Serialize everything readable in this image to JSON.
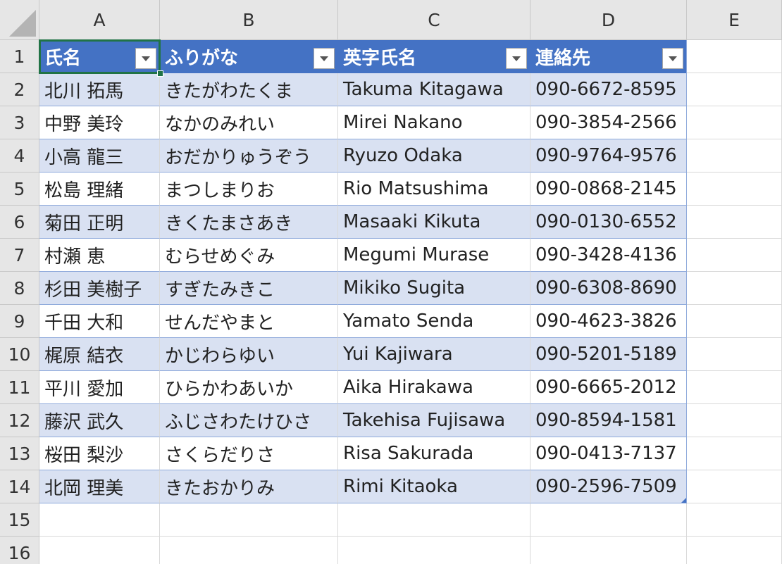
{
  "columns": [
    "A",
    "B",
    "C",
    "D",
    "E"
  ],
  "rows": [
    "1",
    "2",
    "3",
    "4",
    "5",
    "6",
    "7",
    "8",
    "9",
    "10",
    "11",
    "12",
    "13",
    "14",
    "15",
    "16"
  ],
  "table": {
    "headers": [
      "氏名",
      "ふりがな",
      "英字氏名",
      "連絡先"
    ],
    "records": [
      [
        "北川 拓馬",
        "きたがわたくま",
        "Takuma Kitagawa",
        "090-6672-8595"
      ],
      [
        "中野 美玲",
        "なかのみれい",
        "Mirei Nakano",
        "090-3854-2566"
      ],
      [
        "小高 龍三",
        "おだかりゅうぞう",
        "Ryuzo Odaka",
        "090-9764-9576"
      ],
      [
        "松島 理緒",
        "まつしまりお",
        "Rio Matsushima",
        "090-0868-2145"
      ],
      [
        "菊田 正明",
        "きくたまさあき",
        "Masaaki Kikuta",
        "090-0130-6552"
      ],
      [
        "村瀬 恵",
        "むらせめぐみ",
        "Megumi Murase",
        "090-3428-4136"
      ],
      [
        "杉田 美樹子",
        "すぎたみきこ",
        "Mikiko Sugita",
        "090-6308-8690"
      ],
      [
        "千田 大和",
        "せんだやまと",
        "Yamato Senda",
        "090-4623-3826"
      ],
      [
        "梶原 結衣",
        "かじわらゆい",
        "Yui Kajiwara",
        "090-5201-5189"
      ],
      [
        "平川 愛加",
        "ひらかわあいか",
        "Aika Hirakawa",
        "090-6665-2012"
      ],
      [
        "藤沢 武久",
        "ふじさわたけひさ",
        "Takehisa Fujisawa",
        "090-8594-1581"
      ],
      [
        "桜田 梨沙",
        "さくらだりさ",
        "Risa Sakurada",
        "090-0413-7137"
      ],
      [
        "北岡 理美",
        "きたおかりみ",
        "Rimi Kitaoka",
        "090-2596-7509"
      ]
    ]
  },
  "selected_cell": "A1",
  "colors": {
    "header_fill": "#4472c4",
    "band_fill": "#d9e1f2",
    "selection": "#217346"
  }
}
